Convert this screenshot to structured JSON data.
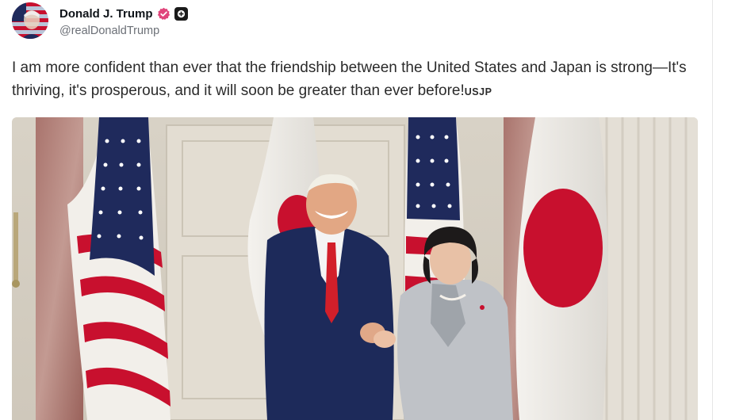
{
  "author": {
    "display_name": "Donald J. Trump",
    "handle": "@realDonaldTrump",
    "avatar_icon": "avatar-flag-portrait",
    "verified_icon": "verified-badge-icon",
    "verified_color": "#e0457b",
    "plus_icon": "plus-badge-icon"
  },
  "post": {
    "text": "I am more confident than ever that the friendship between the United States and Japan is strong—It's thriving, it's prosperous, and it will soon be greater than ever before!",
    "tag": "USJP"
  },
  "media": {
    "type": "photo",
    "description_icon": "handshake-photo"
  },
  "colors": {
    "text": "#2b2b2b",
    "handle": "#6b6f76",
    "flag_red": "#c8102e",
    "flag_blue": "#1f2a5c"
  }
}
